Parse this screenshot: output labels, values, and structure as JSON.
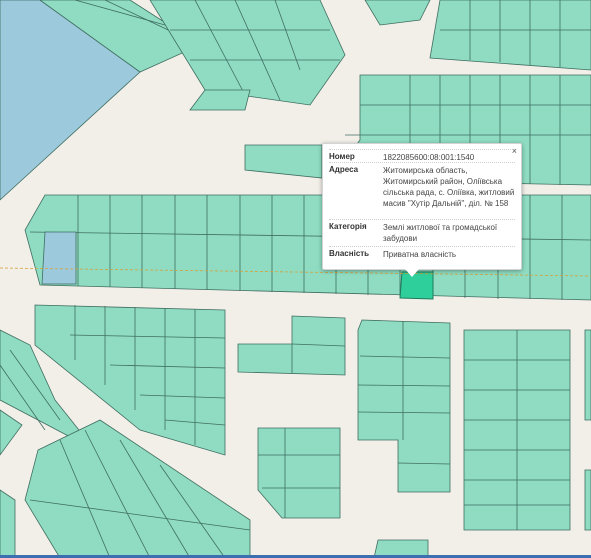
{
  "popup": {
    "close": "×",
    "rows": [
      {
        "key": "Номер",
        "value": "1822085600:08:001:1540"
      },
      {
        "key": "Адреса",
        "value": "Житомирська область, Житомирський район, Оліївська сільська рада, с. Оліївка, житловий масив \"Хутір Дальній\", діл. № 158"
      },
      {
        "key": "Категорія",
        "value": "Землі житлової та громадської забудови"
      },
      {
        "key": "Власність",
        "value": "Приватна власність"
      }
    ]
  },
  "colors": {
    "background": "#f2efe9",
    "parcel": "#8fdcc2",
    "parcel_blue": "#9cc9dc",
    "selected_parcel": "#2ecf9a",
    "boundary_line": "#d4a13a"
  }
}
